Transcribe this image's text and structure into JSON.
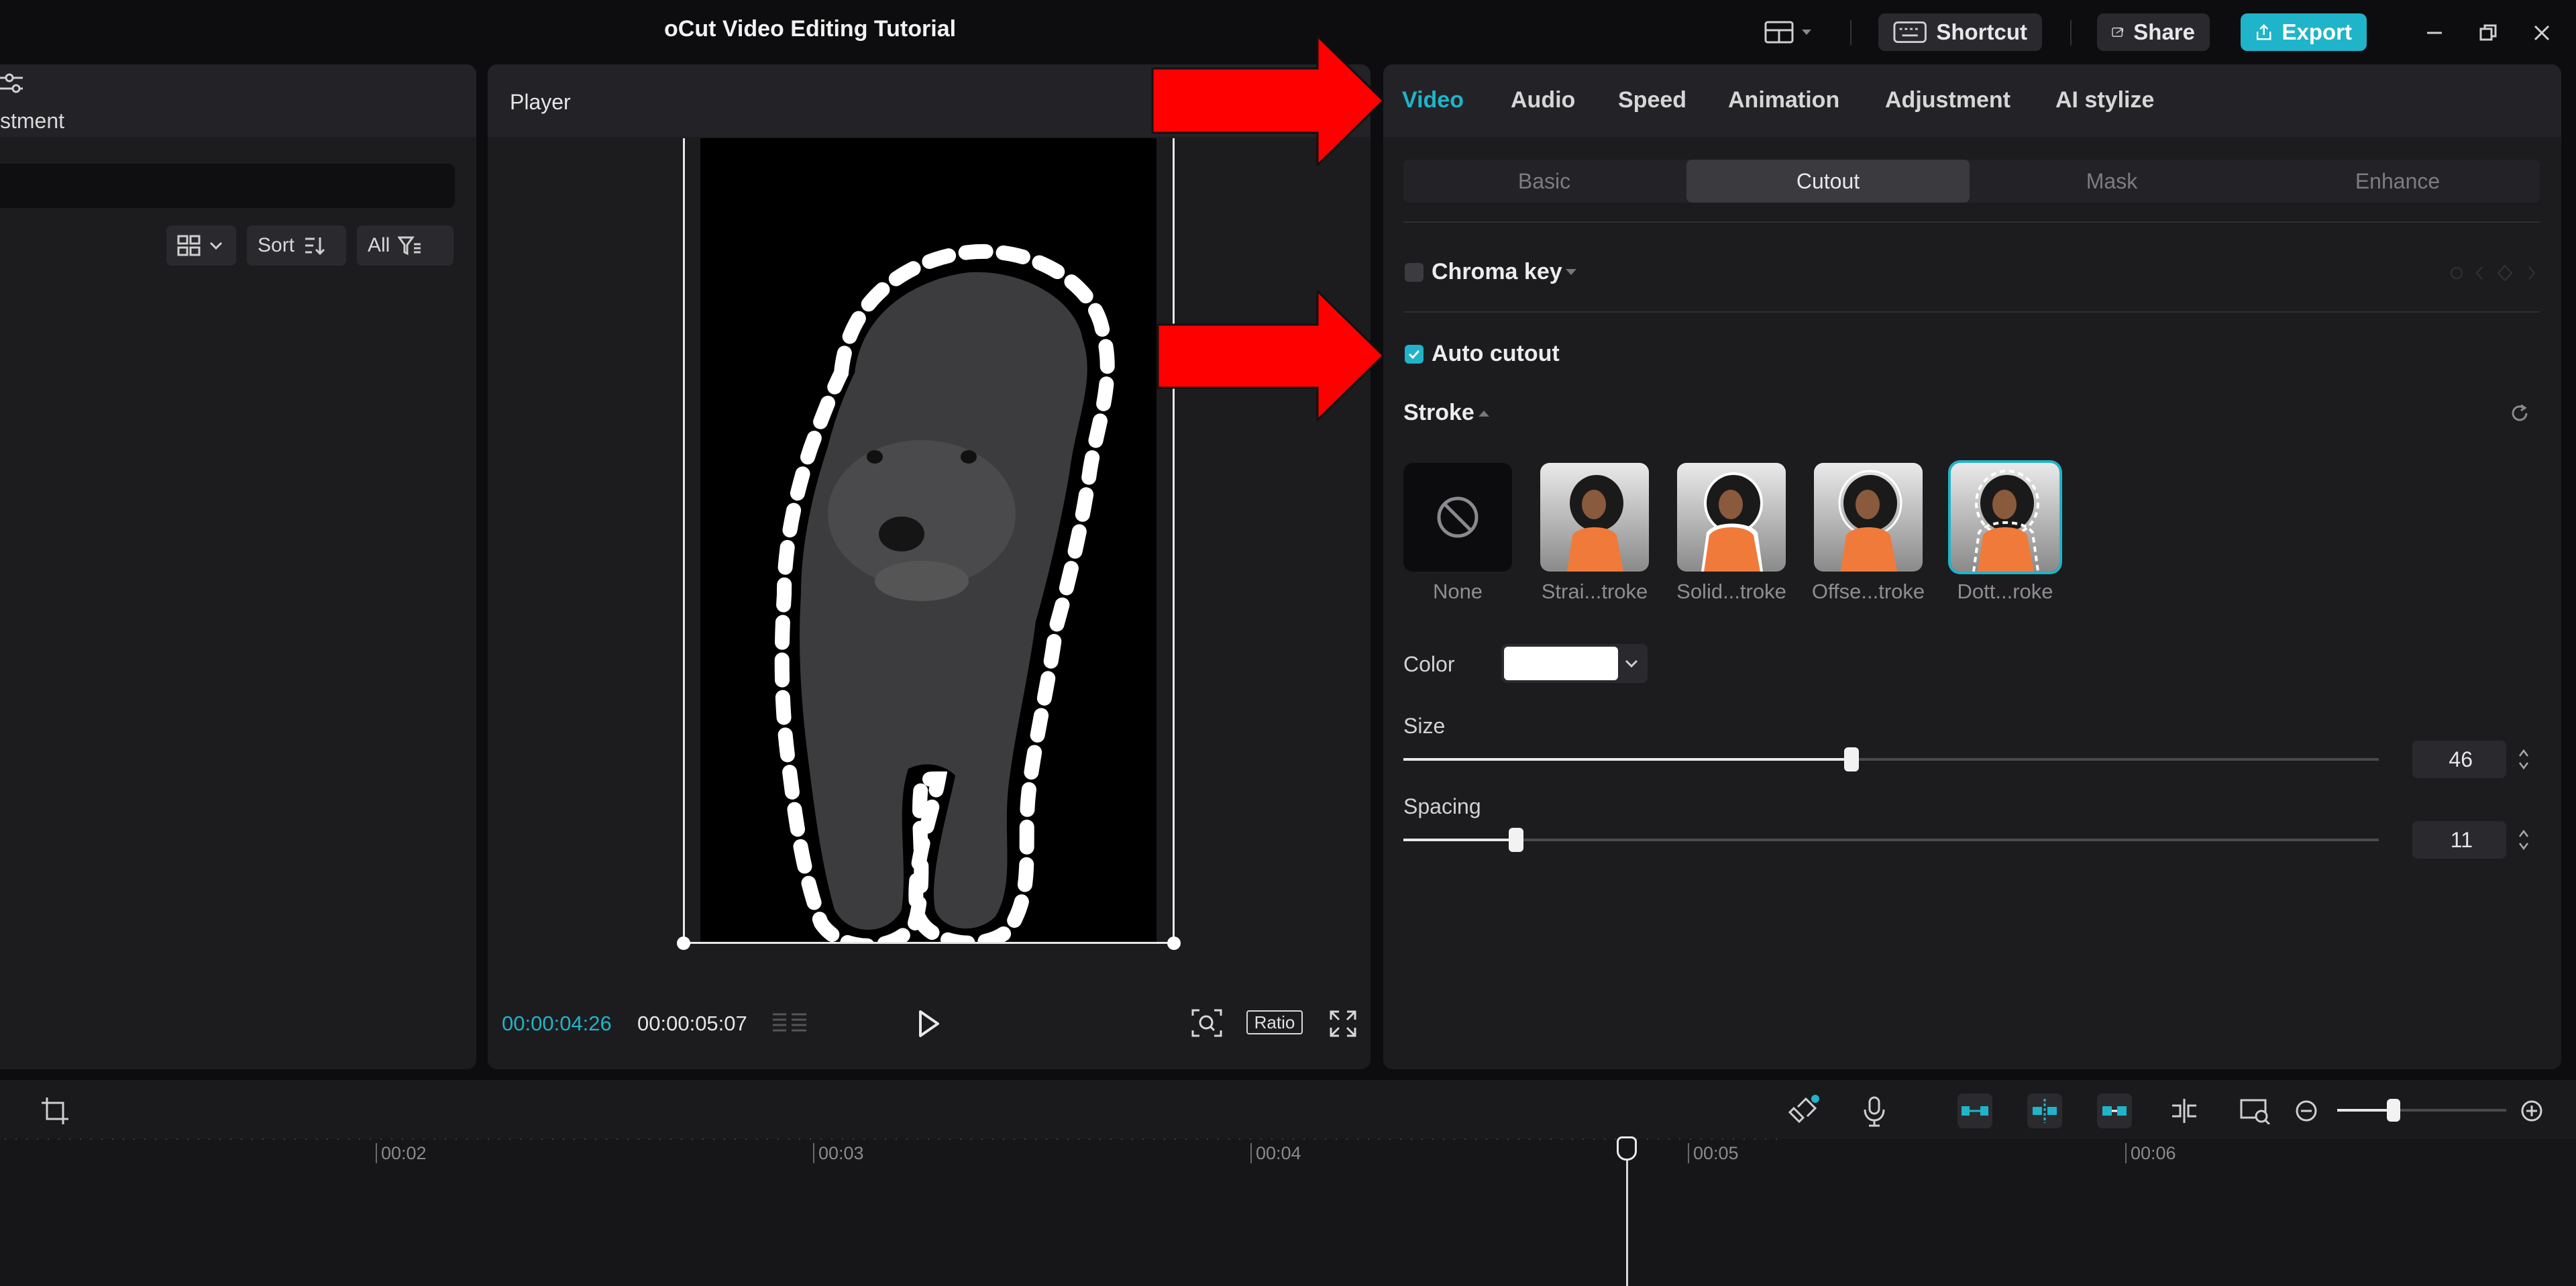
{
  "app": {
    "title": "oCut Video Editing Tutorial",
    "shortcut_label": "Shortcut",
    "share_label": "Share",
    "export_label": "Export"
  },
  "left_panel": {
    "header_label": "stment",
    "sort_label": "Sort",
    "filter_label": "All"
  },
  "player": {
    "title": "Player",
    "time_current": "00:00:04:26",
    "time_total": "00:00:05:07",
    "ratio_label": "Ratio"
  },
  "properties": {
    "tabs": [
      "Video",
      "Audio",
      "Speed",
      "Animation",
      "Adjustment",
      "AI stylize"
    ],
    "active_tab": "Video",
    "subtabs": [
      "Basic",
      "Cutout",
      "Mask",
      "Enhance"
    ],
    "active_subtab": "Cutout",
    "chroma_key": {
      "label": "Chroma key",
      "checked": false
    },
    "auto_cutout": {
      "label": "Auto cutout",
      "checked": true
    },
    "stroke_label": "Stroke",
    "stroke_styles": [
      "None",
      "Strai...troke",
      "Solid...troke",
      "Offse...troke",
      "Dott...roke"
    ],
    "selected_stroke": "Dott...roke",
    "color_label": "Color",
    "color_value": "#ffffff",
    "size_label": "Size",
    "size_value": "46",
    "spacing_label": "Spacing",
    "spacing_value": "11"
  },
  "timeline": {
    "ticks": [
      "00:02",
      "00:03",
      "00:04",
      "00:05",
      "00:06"
    ]
  },
  "colors": {
    "accent": "#1fb4c9",
    "annotation_arrow": "#ff0000"
  }
}
